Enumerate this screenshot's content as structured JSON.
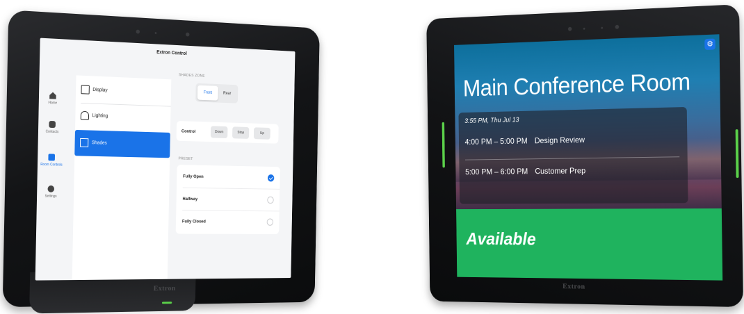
{
  "left_panel": {
    "app_title": "Extron Control",
    "nav": [
      {
        "label": "Home",
        "icon": "home-icon"
      },
      {
        "label": "Contacts",
        "icon": "contacts-icon"
      },
      {
        "label": "Room Controls",
        "icon": "room-controls-icon"
      },
      {
        "label": "Settings",
        "icon": "gear-icon"
      }
    ],
    "nav_active": "Room Controls",
    "devices": [
      {
        "label": "Display",
        "icon": "display-icon"
      },
      {
        "label": "Lighting",
        "icon": "lighting-icon"
      },
      {
        "label": "Shades",
        "icon": "shades-icon"
      }
    ],
    "device_active": "Shades",
    "shades_zone": {
      "title": "SHADES ZONE",
      "options": [
        "Front",
        "Rear"
      ],
      "selected": "Front"
    },
    "control": {
      "label": "Control",
      "buttons": [
        "Down",
        "Stop",
        "Up"
      ]
    },
    "preset": {
      "title": "PRESET",
      "options": [
        "Fully Open",
        "Halfway",
        "Fully Closed"
      ],
      "selected": "Fully Open"
    },
    "brand": "Extron"
  },
  "right_panel": {
    "room_name": "Main Conference Room",
    "current_time": "3:55 PM, Thu Jul 13",
    "meetings": [
      {
        "time": "4:00 PM – 5:00 PM",
        "title": "Design Review"
      },
      {
        "time": "5:00 PM – 6:00 PM",
        "title": "Customer Prep"
      }
    ],
    "status": "Available",
    "brand": "Extron"
  },
  "colors": {
    "accent": "#1a73e8",
    "available_green": "#1fb35e",
    "led_green": "#5bd14a"
  }
}
